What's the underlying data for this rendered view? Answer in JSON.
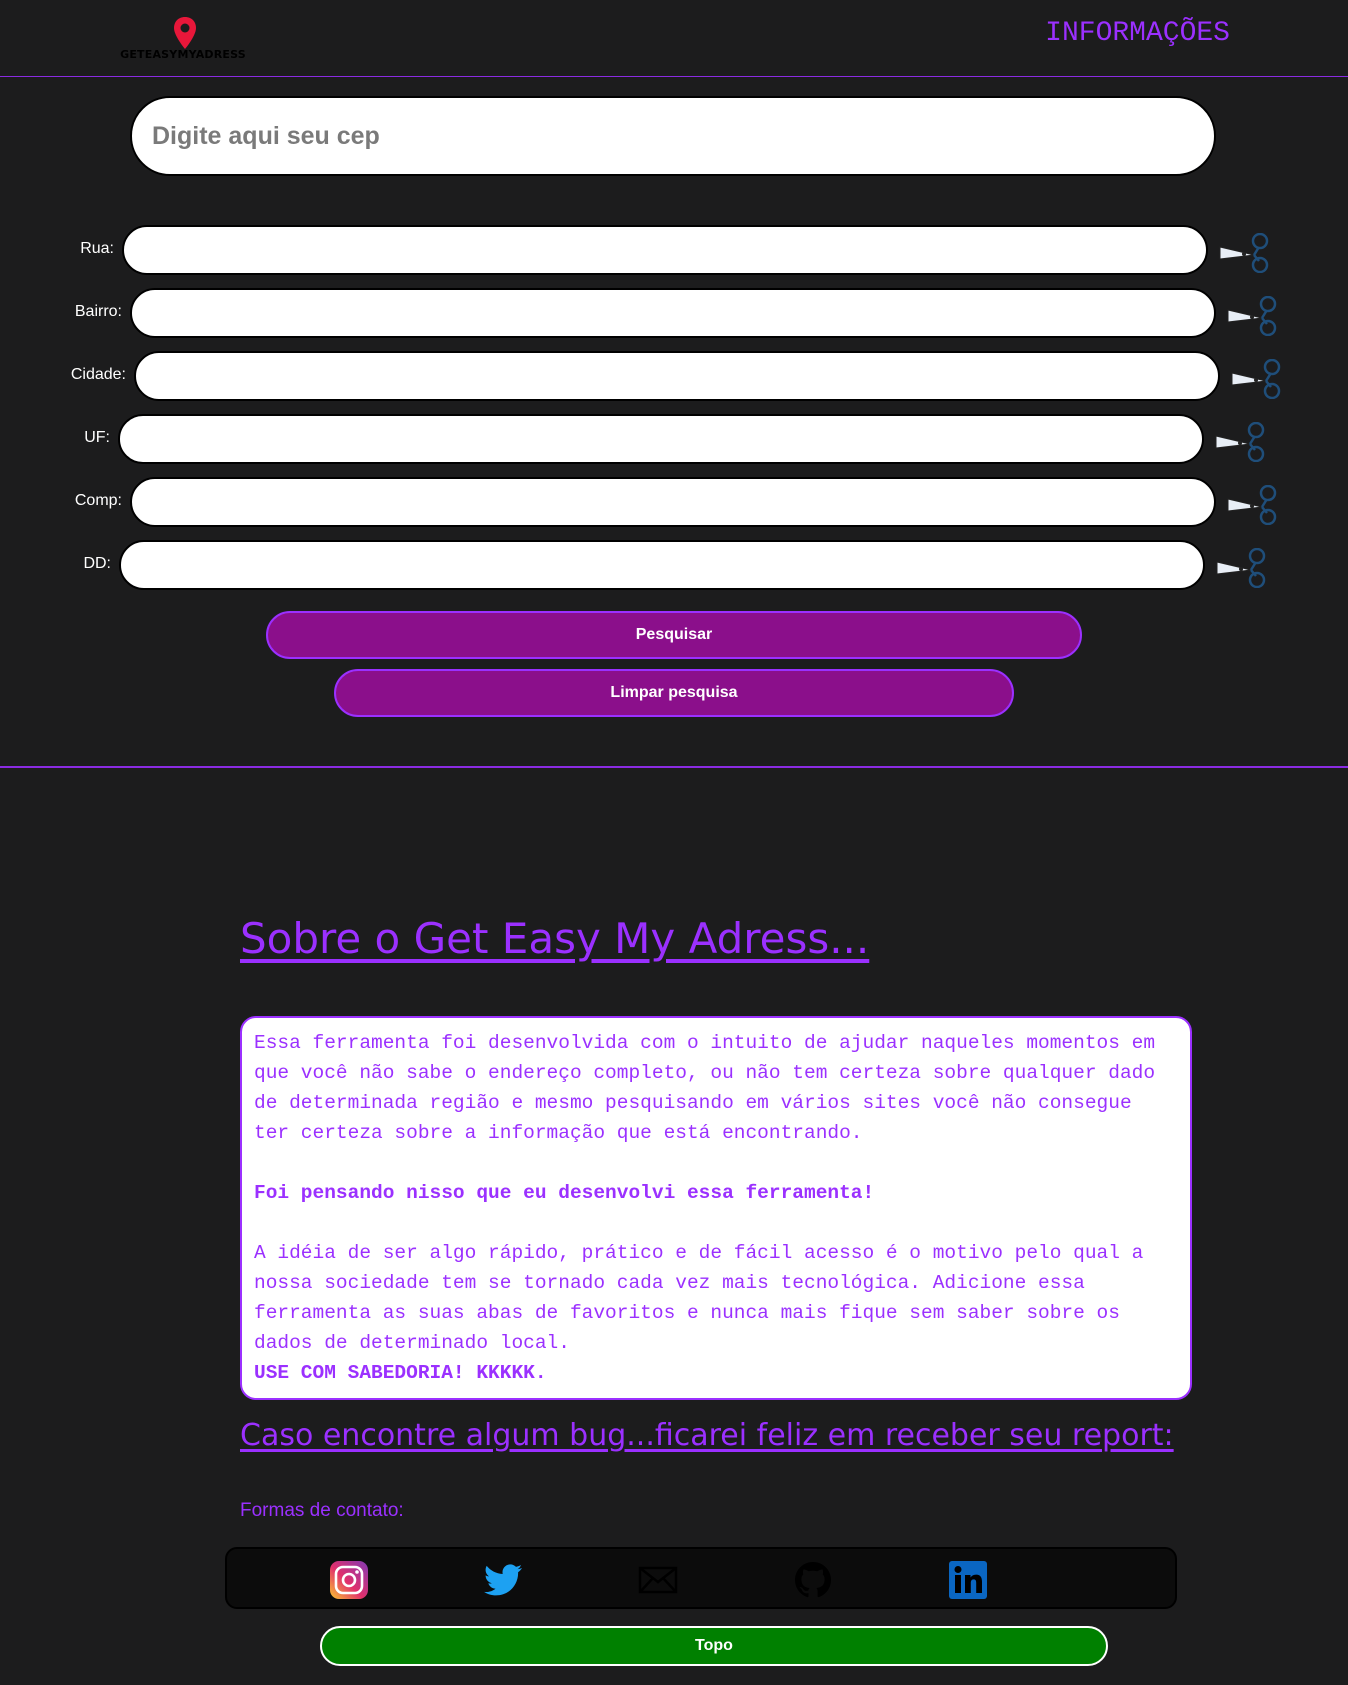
{
  "header": {
    "logo_text": "GETEASYMYADRESS",
    "info_link": "INFORMAÇÕES"
  },
  "search": {
    "cep_placeholder": "Digite aqui seu cep"
  },
  "form": {
    "fields": [
      {
        "label": "Rua:",
        "value": ""
      },
      {
        "label": "Bairro:",
        "value": ""
      },
      {
        "label": "Cidade:",
        "value": ""
      },
      {
        "label": "UF:",
        "value": ""
      },
      {
        "label": "Comp:",
        "value": ""
      },
      {
        "label": "DD:",
        "value": ""
      }
    ],
    "search_button": "Pesquisar",
    "clear_button": "Limpar pesquisa"
  },
  "about": {
    "title": "Sobre o Get Easy My Adress...",
    "paragraph1": "Essa ferramenta foi desenvolvida com o intuito de ajudar naqueles momentos em que você não sabe o endereço completo, ou não tem certeza sobre qualquer dado de determinada região e mesmo pesquisando em vários sites você não consegue ter certeza sobre a informação que está encontrando.",
    "paragraph2": "Foi pensando nisso que eu desenvolvi essa ferramenta!",
    "paragraph3": "A idéia de ser algo rápido, prático e de fácil acesso é o motivo pelo qual a nossa sociedade tem se tornado cada vez mais tecnológica. Adicione essa ferramenta as suas abas de favoritos e nunca mais fique sem saber sobre os dados de determinado local.",
    "paragraph4": "USE COM SABEDORIA! KKKKK."
  },
  "contact": {
    "bug_title": "Caso encontre algum bug...ficarei feliz em receber seu report:",
    "label": "Formas de contato:",
    "icons": [
      "instagram-icon",
      "twitter-icon",
      "email-icon",
      "github-icon",
      "linkedin-icon"
    ]
  },
  "footer": {
    "top_button": "Topo"
  },
  "colors": {
    "background": "#1c1c1d",
    "accent": "#9b30ff",
    "button": "#8b0f8b",
    "top_button": "#008000",
    "logo_pin": "#e8173a"
  }
}
